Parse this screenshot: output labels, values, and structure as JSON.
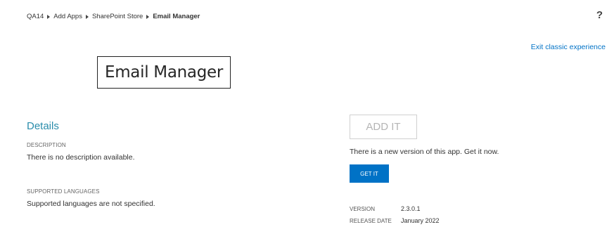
{
  "breadcrumb": {
    "items": [
      "QA14",
      "Add Apps",
      "SharePoint Store"
    ],
    "current": "Email Manager"
  },
  "help_icon": "?",
  "exit_link": "Exit classic experience",
  "app_title": "Email Manager",
  "details": {
    "heading": "Details",
    "description_label": "DESCRIPTION",
    "description_value": "There is no description available.",
    "languages_label": "SUPPORTED LANGUAGES",
    "languages_value": "Supported languages are not specified."
  },
  "actions": {
    "add_it_label": "ADD IT",
    "new_version_text": "There is a new version of this app. Get it now.",
    "get_it_label": "GET IT"
  },
  "meta": {
    "version_label": "VERSION",
    "version_value": "2.3.0.1",
    "release_label": "RELEASE DATE",
    "release_value": "January 2022"
  },
  "colors": {
    "link": "#0072c6",
    "heading": "#2a8dab",
    "primary_button": "#0072c6"
  }
}
